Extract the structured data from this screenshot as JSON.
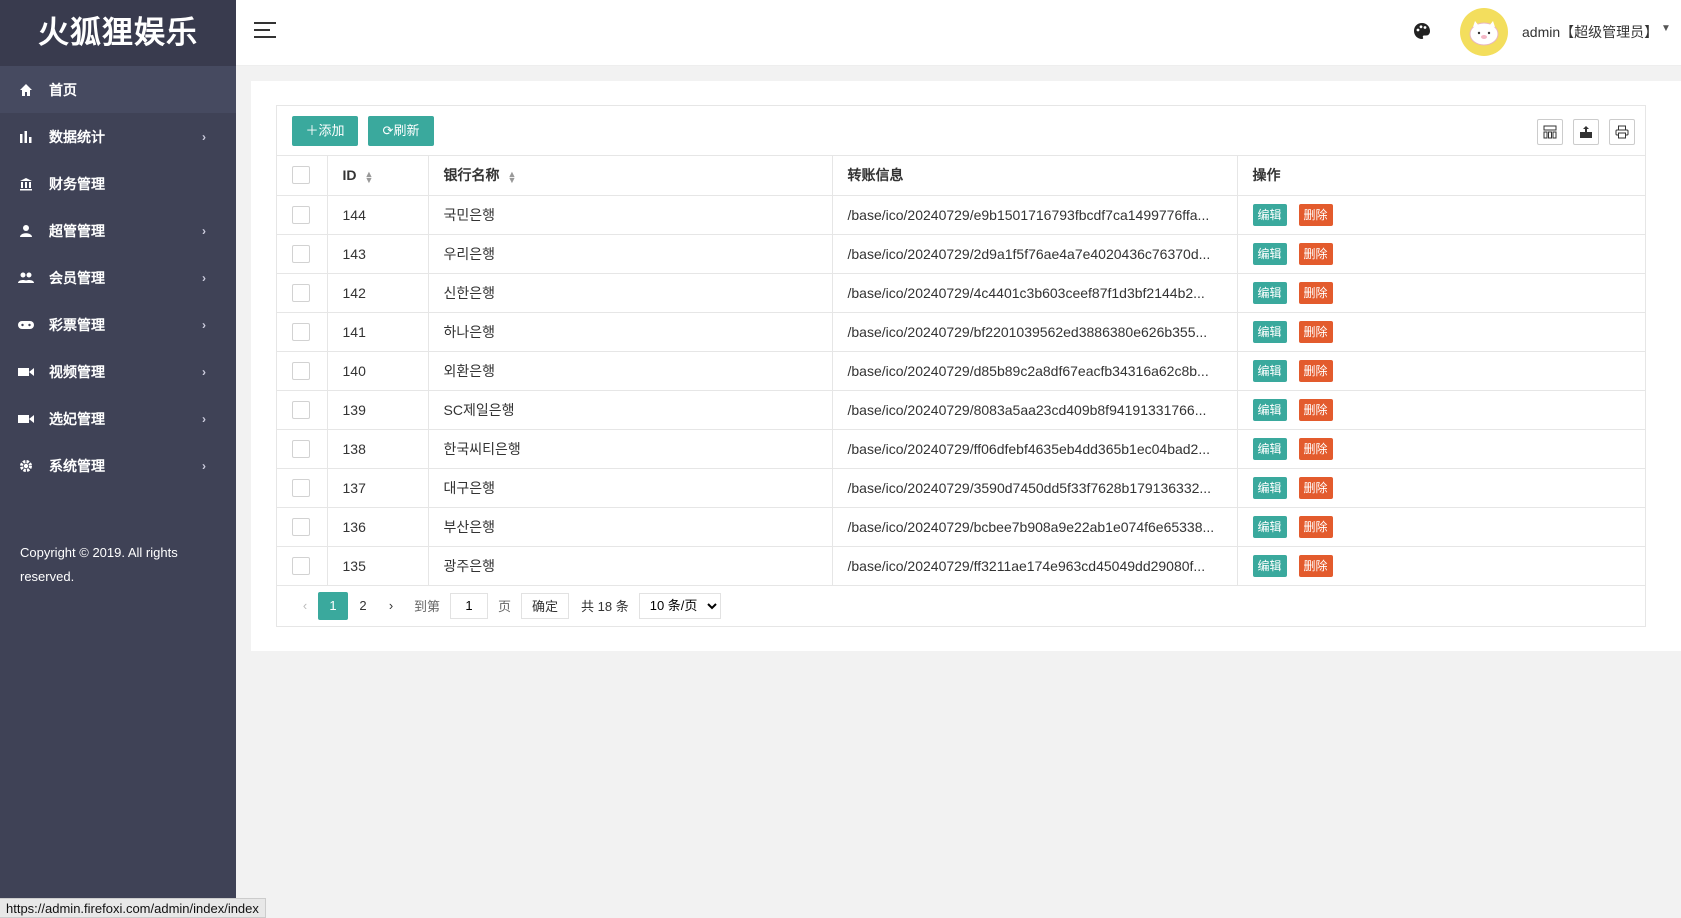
{
  "sidebar": {
    "logo": "火狐狸娱乐",
    "items": [
      {
        "label": "首页",
        "icon": "home-icon",
        "has_arrow": false
      },
      {
        "label": "数据统计",
        "icon": "bar-chart-icon",
        "has_arrow": true
      },
      {
        "label": "财务管理",
        "icon": "bank-icon",
        "has_arrow": false
      },
      {
        "label": "超管管理",
        "icon": "user-icon",
        "has_arrow": true
      },
      {
        "label": "会员管理",
        "icon": "users-icon",
        "has_arrow": true
      },
      {
        "label": "彩票管理",
        "icon": "gamepad-icon",
        "has_arrow": true
      },
      {
        "label": "视频管理",
        "icon": "video-icon",
        "has_arrow": true
      },
      {
        "label": "选妃管理",
        "icon": "video-icon",
        "has_arrow": true
      },
      {
        "label": "系统管理",
        "icon": "gear-icon",
        "has_arrow": true
      }
    ],
    "copyright": "Copyright © 2019. All rights reserved."
  },
  "header": {
    "user": "admin【超级管理员】"
  },
  "toolbar": {
    "add_label": "添加",
    "refresh_label": "刷新"
  },
  "table": {
    "columns": [
      "ID",
      "银行名称",
      "转账信息",
      "操作"
    ],
    "edit_label": "编辑",
    "delete_label": "删除",
    "rows": [
      {
        "id": "144",
        "bank": "국민은행",
        "info": "/base/ico/20240729/e9b1501716793fbcdf7ca1499776ffa..."
      },
      {
        "id": "143",
        "bank": "우리은행",
        "info": "/base/ico/20240729/2d9a1f5f76ae4a7e4020436c76370d..."
      },
      {
        "id": "142",
        "bank": "신한은행",
        "info": "/base/ico/20240729/4c4401c3b603ceef87f1d3bf2144b2..."
      },
      {
        "id": "141",
        "bank": "하나은행",
        "info": "/base/ico/20240729/bf2201039562ed3886380e626b355..."
      },
      {
        "id": "140",
        "bank": "외환은행",
        "info": "/base/ico/20240729/d85b89c2a8df67eacfb34316a62c8b..."
      },
      {
        "id": "139",
        "bank": "SC제일은행",
        "info": "/base/ico/20240729/8083a5aa23cd409b8f94191331766..."
      },
      {
        "id": "138",
        "bank": "한국씨티은행",
        "info": "/base/ico/20240729/ff06dfebf4635eb4dd365b1ec04bad2..."
      },
      {
        "id": "137",
        "bank": "대구은행",
        "info": "/base/ico/20240729/3590d7450dd5f33f7628b179136332..."
      },
      {
        "id": "136",
        "bank": "부산은행",
        "info": "/base/ico/20240729/bcbee7b908a9e22ab1e074f6e65338..."
      },
      {
        "id": "135",
        "bank": "광주은행",
        "info": "/base/ico/20240729/ff3211ae174e963cd45049dd29080f..."
      }
    ]
  },
  "pager": {
    "pages": [
      "1",
      "2"
    ],
    "goto_label": "到第",
    "page_input": "1",
    "page_unit": "页",
    "confirm_label": "确定",
    "total_label": "共 18 条",
    "per_page": "10 条/页"
  },
  "status_url": "https://admin.firefoxi.com/admin/index/index"
}
